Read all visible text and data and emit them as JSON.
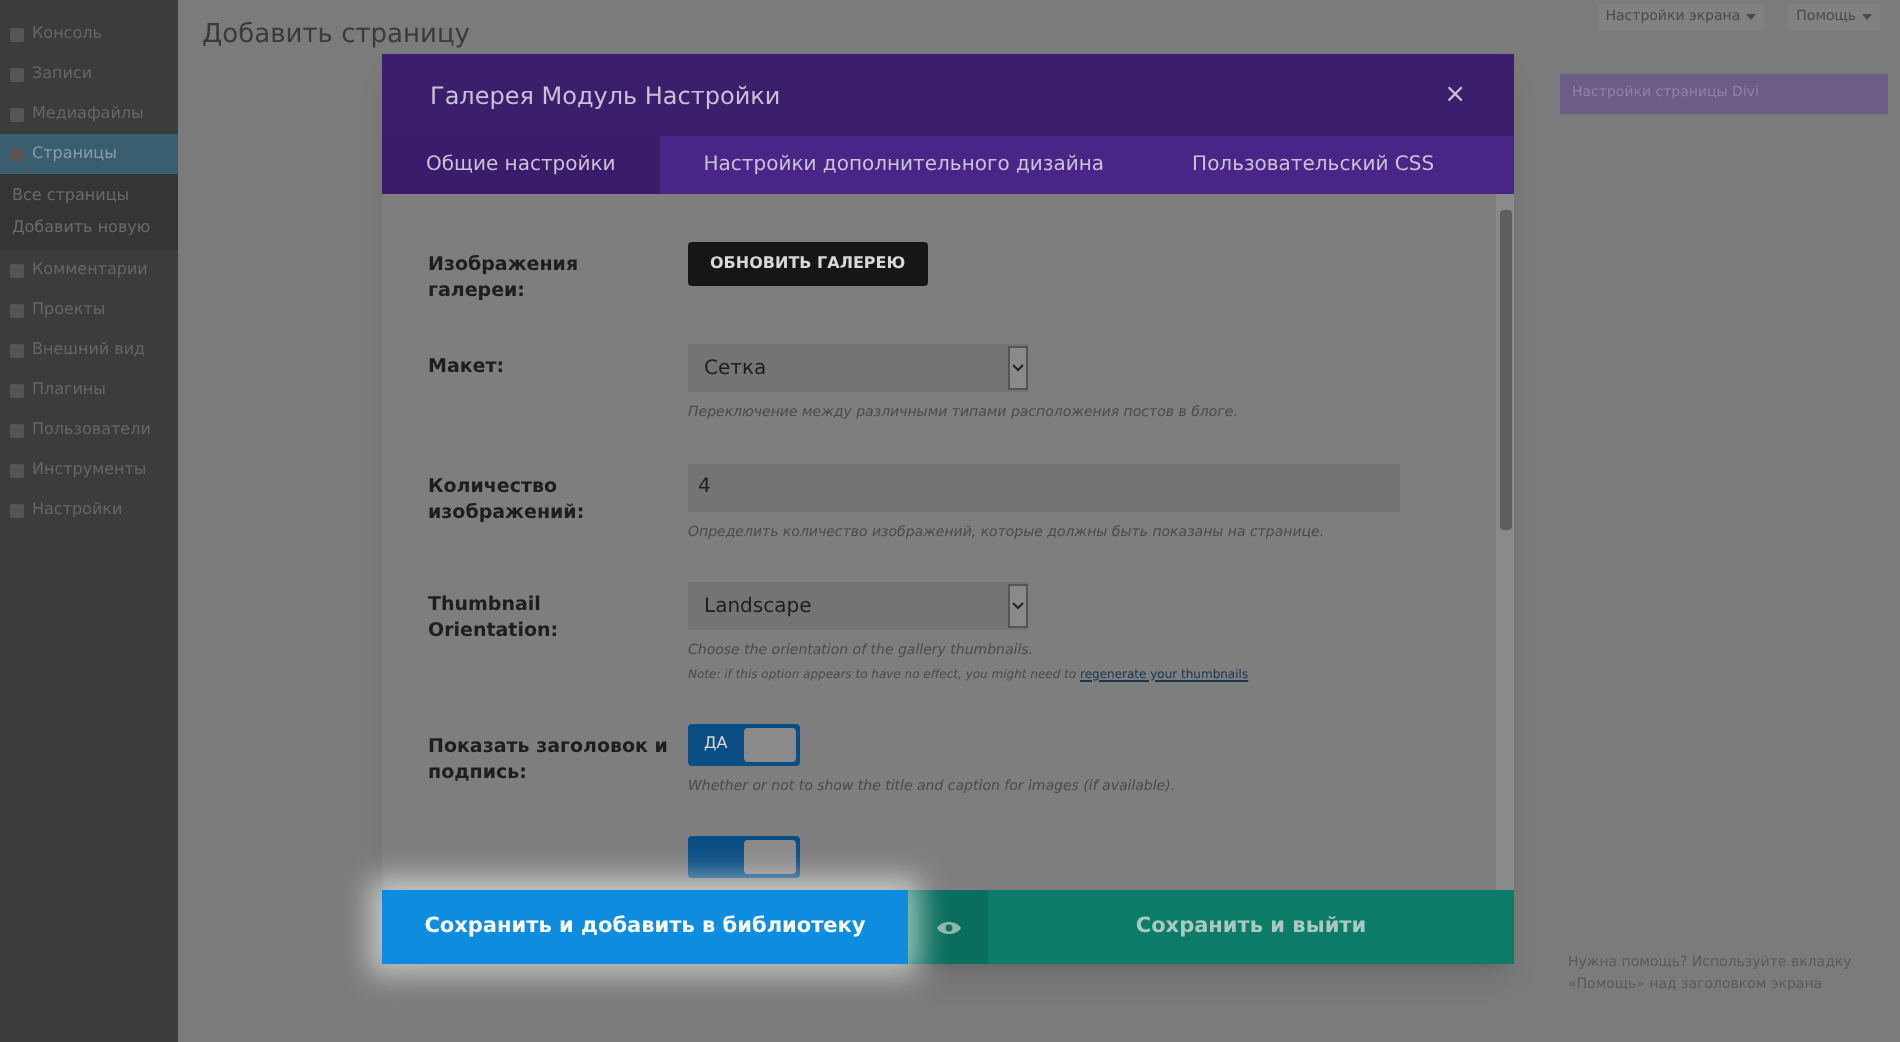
{
  "admin_menu": [
    {
      "label": "Консоль",
      "selected": false
    },
    {
      "label": "Записи",
      "selected": false
    },
    {
      "label": "Медиафайлы",
      "selected": false
    },
    {
      "label": "Страницы",
      "selected": true,
      "children": [
        {
          "label": "Все страницы"
        },
        {
          "label": "Добавить новую"
        }
      ]
    },
    {
      "label": "Комментарии",
      "selected": false
    },
    {
      "label": "Проекты",
      "selected": false
    },
    {
      "label": "Внешний вид",
      "selected": false
    },
    {
      "label": "Плагины",
      "selected": false
    },
    {
      "label": "Пользователи",
      "selected": false
    },
    {
      "label": "Инструменты",
      "selected": false
    },
    {
      "label": "Настройки",
      "selected": false
    }
  ],
  "page_title": "Добавить страницу",
  "top_buttons": [
    "Настройки экрана",
    "Помощь"
  ],
  "side_panel": {
    "title": "Настройки страницы Divi",
    "help_text": "Нужна помощь? Используйте вкладку «Помощь» над заголовком экрана"
  },
  "modal": {
    "title": "Галерея Модуль Настройки",
    "close": "×",
    "tabs": [
      {
        "label": "Общие настройки",
        "selected": true
      },
      {
        "label": "Настройки дополнительного дизайна",
        "selected": false
      },
      {
        "label": "Пользовательский CSS",
        "selected": false
      }
    ],
    "fields": [
      {
        "kind": "button",
        "label": "Изображения галереи:",
        "button": "ОБНОВИТЬ ГАЛЕРЕЮ"
      },
      {
        "kind": "select",
        "label": "Макет:",
        "value": "Сетка",
        "hint": "Переключение между различными типами расположения постов в блоге."
      },
      {
        "kind": "input",
        "label": "Количество изображений:",
        "value": "4",
        "hint": "Определить количество изображений, которые должны быть показаны на странице."
      },
      {
        "kind": "select",
        "label": "Thumbnail Orientation:",
        "value": "Landscape",
        "hint": "Choose the orientation of the gallery thumbnails.",
        "note": "Note: if this option appears to have no effect, you might need to",
        "note_link": "regenerate your thumbnails"
      },
      {
        "kind": "toggle",
        "label": "Показать заголовок и подпись:",
        "on": true,
        "toggle_label": "ДА",
        "hint": "Whether or not to show the title and caption for images (if available)."
      },
      {
        "kind": "toggle",
        "on": true
      }
    ],
    "footer": {
      "save_library": "Сохранить и добавить в библиотеку",
      "save_exit": "Сохранить и выйти"
    }
  }
}
